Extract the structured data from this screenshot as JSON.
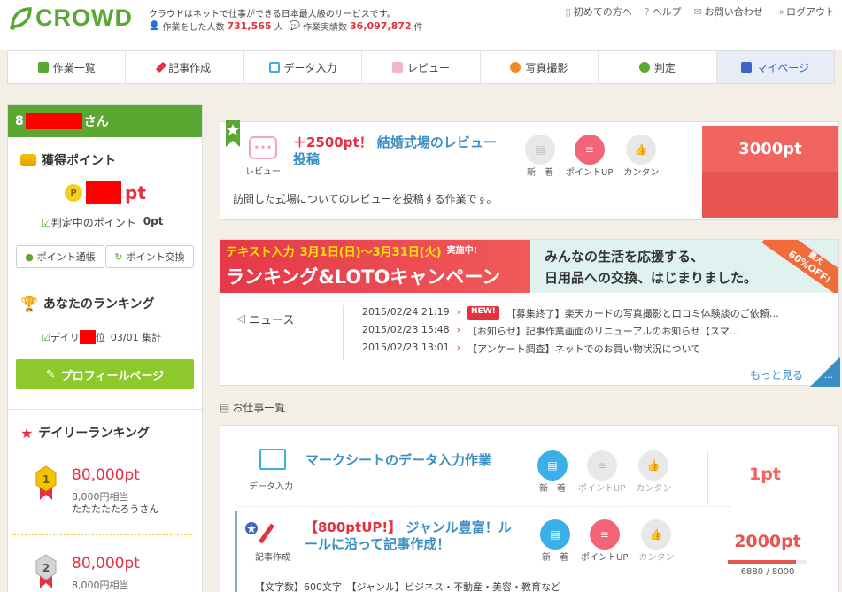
{
  "header": {
    "logo_text": "CROWD",
    "tagline": "クラウドはネットで仕事ができる日本最大級のサービスです。",
    "workers_label": "作業をした人数",
    "workers_count": "731,565",
    "workers_unit": "人",
    "tasks_label": "作業実績数",
    "tasks_count": "36,097,872",
    "tasks_unit": "件",
    "links": [
      "初めての方へ",
      "ヘルプ",
      "お問い合わせ",
      "ログアウト"
    ]
  },
  "nav": {
    "tabs": [
      "作業一覧",
      "記事作成",
      "データ入力",
      "レビュー",
      "写真撮影",
      "判定",
      "マイページ"
    ]
  },
  "sidebar": {
    "user_prefix": "8",
    "user_suffix": "さん",
    "points_title": "獲得ポイント",
    "points_unit": "pt",
    "pending_label": "判定中のポイント",
    "pending_value": "0pt",
    "btn_history": "ポイント通帳",
    "btn_exchange": "ポイント交換",
    "ranking_title": "あなたのランキング",
    "daily_prefix": "デイリ",
    "daily_suffix": "位",
    "daily_date": "03/01 集計",
    "profile_btn": "プロフィールページ",
    "daily_ranking_title": "デイリーランキング",
    "ranks": [
      {
        "rank": "1",
        "points": "80,000pt",
        "yen": "8,000円相当",
        "name": "たたたたたろうさん"
      },
      {
        "rank": "2",
        "points": "80,000pt",
        "yen": "8,000円相当",
        "name": ""
      }
    ]
  },
  "featured": {
    "category": "レビュー",
    "title_points": "＋2500pt！",
    "title_text": "結婚式場のレビュー投稿",
    "badges": [
      "新　着",
      "ポイントUP",
      "カンタン"
    ],
    "reward": "3000pt",
    "description": "訪問した式場についてのレビューを投稿する作業です。"
  },
  "banner": {
    "left_top": "テキスト入力",
    "left_dates": "3月1日(日)〜3月31日(火)",
    "left_tag": "実施中!",
    "left_main": "ランキング&LOTOキャンペーン",
    "right_line1": "みんなの生活を応援する、",
    "right_line2": "日用品への交換、はじまりました。",
    "corner_top": "最大",
    "corner_main": "60%OFF!"
  },
  "news": {
    "label": "ニュース",
    "items": [
      {
        "date": "2015/02/24 21:19",
        "new": "NEW!",
        "text": "【募集終了】楽天カードの写真撮影と口コミ体験談のご依頼…"
      },
      {
        "date": "2015/02/23 15:48",
        "new": "",
        "text": "【お知らせ】記事作業画面のリニューアルのお知らせ【スマ…"
      },
      {
        "date": "2015/02/23 13:01",
        "new": "",
        "text": "【アンケート調査】ネットでのお買い物状況について"
      }
    ],
    "more": "もっと見る",
    "corner": "…"
  },
  "jobs": {
    "section_title": "お仕事一覧",
    "items": [
      {
        "category": "データ入力",
        "title": "マークシートのデータ入力作業",
        "badges": [
          "新　着",
          "ポイントUP",
          "カンタン"
        ],
        "reward": "1pt"
      },
      {
        "category": "記事作成",
        "title_points": "【800ptUP!】",
        "title_text": "ジャンル豊富！ルールに沿って記事作成！",
        "badges": [
          "新　着",
          "ポイントUP",
          "カンタン"
        ],
        "reward": "2000pt",
        "progress_text": "6880 / 8000",
        "progress": 0.86,
        "detail": "【文字数】600文字　【ジャンル】ビジネス・不動産・美容・教育など"
      }
    ]
  },
  "colors": {
    "brand_green": "#5aa832",
    "accent_red": "#e53040",
    "link_blue": "#3b8fc4",
    "reward_bg": "#f2645e"
  }
}
